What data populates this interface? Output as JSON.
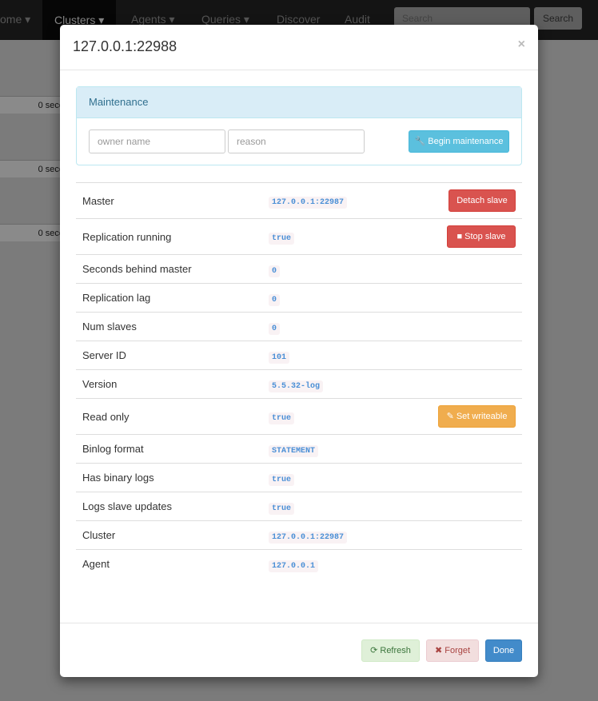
{
  "navbar": {
    "items": [
      "ome ▾",
      "Clusters ▾",
      "Agents ▾",
      "Queries ▾",
      "Discover",
      "Audit"
    ],
    "search_placeholder": "Search",
    "search_button": "Search"
  },
  "background": {
    "rows": [
      "0 seco",
      "0 seco",
      "0 seco"
    ]
  },
  "modal": {
    "title": "127.0.0.1:22988",
    "close": "×",
    "maintenance": {
      "heading": "Maintenance",
      "owner_placeholder": "owner name",
      "reason_placeholder": "reason",
      "begin_label": "Begin maintenance"
    },
    "rows": [
      {
        "key": "Master",
        "value": "127.0.0.1:22987",
        "action": "Detach slave"
      },
      {
        "key": "Replication running",
        "value": "true",
        "action": "Stop slave"
      },
      {
        "key": "Seconds behind master",
        "value": "0"
      },
      {
        "key": "Replication lag",
        "value": "0"
      },
      {
        "key": "Num slaves",
        "value": "0"
      },
      {
        "key": "Server ID",
        "value": "101"
      },
      {
        "key": "Version",
        "value": "5.5.32-log"
      },
      {
        "key": "Read only",
        "value": "true",
        "action": "Set writeable"
      },
      {
        "key": "Binlog format",
        "value": "STATEMENT"
      },
      {
        "key": "Has binary logs",
        "value": "true"
      },
      {
        "key": "Logs slave updates",
        "value": "true"
      },
      {
        "key": "Cluster",
        "value": "127.0.0.1:22987"
      },
      {
        "key": "Agent",
        "value": "127.0.0.1"
      }
    ],
    "footer": {
      "refresh": "Refresh",
      "forget": "Forget",
      "done": "Done"
    }
  }
}
